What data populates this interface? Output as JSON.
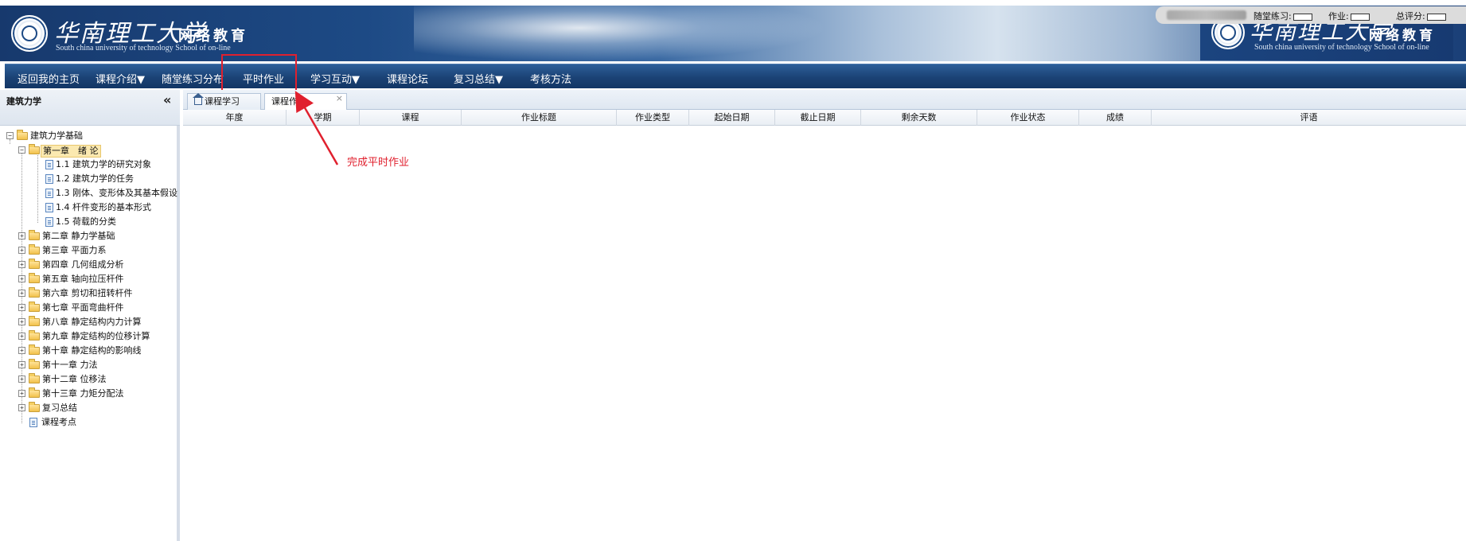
{
  "header": {
    "logo_cn": "华南理工大学",
    "logo_sub": "网络教育",
    "logo_en": "South china university of technology School of on-line"
  },
  "status_bar": {
    "practice_label": "随堂练习:",
    "homework_label": "作业:",
    "total_label": "总评分:"
  },
  "nav": {
    "items": [
      "返回我的主页",
      "课程介绍▼",
      "随堂练习分布",
      "平时作业",
      "学习互动▼",
      "课程论坛",
      "复习总结▼",
      "考核方法"
    ]
  },
  "sidebar": {
    "title": "建筑力学",
    "collapse_glyph": "«",
    "root": "建筑力学基础",
    "chapter1": "第一章　绪 论",
    "sections": [
      "1.1 建筑力学的研究对象",
      "1.2 建筑力学的任务",
      "1.3 刚体、变形体及其基本假设",
      "1.4 杆件变形的基本形式",
      "1.5 荷载的分类"
    ],
    "chapters": [
      "第二章 静力学基础",
      "第三章 平面力系",
      "第四章 几何组成分析",
      "第五章 轴向拉压杆件",
      "第六章 剪切和扭转杆件",
      "第七章 平面弯曲杆件",
      "第八章 静定结构内力计算",
      "第九章 静定结构的位移计算",
      "第十章 静定结构的影响线",
      "第十一章 力法",
      "第十二章 位移法",
      "第十三章 力矩分配法",
      "复习总结"
    ],
    "exam_points": "课程考点"
  },
  "tabs": {
    "items": [
      "课程学习",
      "课程作业"
    ],
    "close_glyph": "×"
  },
  "table": {
    "columns": [
      "年度",
      "学期",
      "课程",
      "作业标题",
      "作业类型",
      "起始日期",
      "截止日期",
      "剩余天数",
      "作业状态",
      "成绩",
      "评语"
    ]
  },
  "annotation": {
    "text": "完成平时作业",
    "color": "#e0202e"
  }
}
